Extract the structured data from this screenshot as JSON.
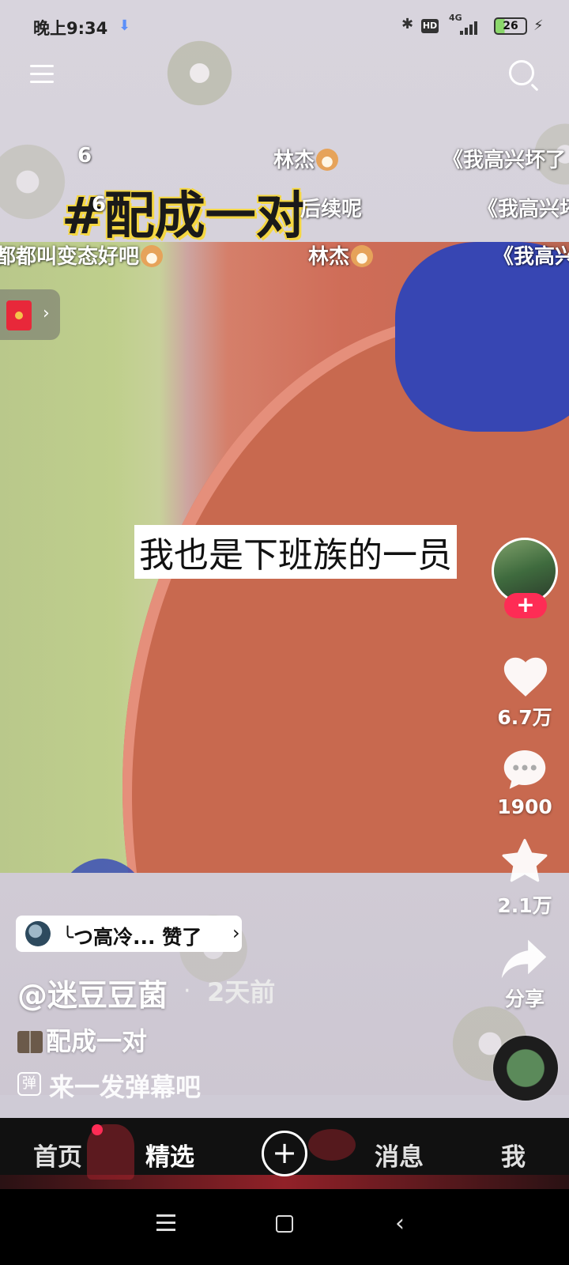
{
  "status_bar": {
    "time": "晚上9:34",
    "network": "4G",
    "hd": "HD",
    "battery": "26"
  },
  "danmaku": [
    {
      "text": "6"
    },
    {
      "text": "林杰"
    },
    {
      "text": "《我高兴坏了"
    },
    {
      "text": "6"
    },
    {
      "text": "后续呢"
    },
    {
      "text": "《我高兴坏"
    },
    {
      "text": "都都叫变态好吧"
    },
    {
      "text": "林杰"
    },
    {
      "text": "《我高兴"
    }
  ],
  "video": {
    "hashtag_title": "#配成一对",
    "subtitle": "我也是下班族的一员"
  },
  "actions": {
    "follow": "+",
    "likes": "6.7万",
    "comments": "1900",
    "favorites": "2.1万",
    "share": "分享"
  },
  "info": {
    "liked_by": "╰つ高冷... 赞了",
    "author": "@迷豆豆菌",
    "dot": "·",
    "time_ago": "2天前",
    "description": "配成一对",
    "danmaku_placeholder": "来一发弹幕吧",
    "danmaku_icon": "弹"
  },
  "nav": {
    "home": "首页",
    "featured": "精选",
    "plus": "+",
    "messages": "消息",
    "me": "我"
  },
  "colors": {
    "accent": "#fe2c55",
    "hashtag_stroke": "#f5d742"
  }
}
